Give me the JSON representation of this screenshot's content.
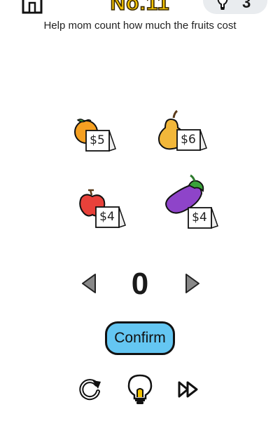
{
  "header": {
    "level": "No.11",
    "hints_remaining": "3"
  },
  "instruction": "Help mom count how much the fruits cost",
  "items": [
    {
      "name": "orange",
      "price": "$5"
    },
    {
      "name": "pear",
      "price": "$6"
    },
    {
      "name": "apple",
      "price": "$4"
    },
    {
      "name": "eggplant",
      "price": "$4"
    }
  ],
  "counter": {
    "value": "0"
  },
  "confirm_label": "Confirm",
  "colors": {
    "level_yellow": "#f2c200",
    "confirm_blue": "#64c6f2",
    "orange": "#f5a021",
    "pear": "#f2b73a",
    "apple": "#e8413a",
    "eggplant": "#8e44c9",
    "leaf_green": "#3aa33a"
  },
  "icons": [
    "home-icon",
    "lightbulb-icon",
    "left-arrow-icon",
    "right-arrow-icon",
    "restart-icon",
    "fast-forward-icon"
  ]
}
